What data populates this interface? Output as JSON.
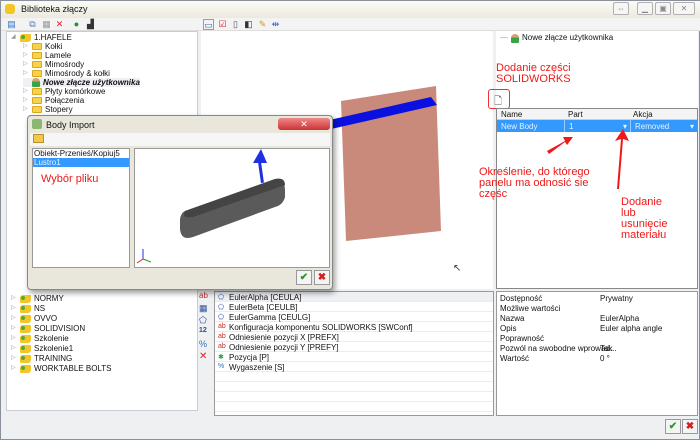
{
  "window": {
    "title": "Biblioteka złączy"
  },
  "tree": {
    "items": [
      {
        "label": "1.HAFELE",
        "type": "library",
        "level": 0,
        "expanded": true
      },
      {
        "label": "Kołki",
        "type": "folder",
        "level": 1
      },
      {
        "label": "Lamele",
        "type": "folder",
        "level": 1
      },
      {
        "label": "Mimośrody",
        "type": "folder",
        "level": 1
      },
      {
        "label": "Mimośrody & kołki",
        "type": "folder",
        "level": 1
      },
      {
        "label": "Nowe złącze użytkownika",
        "type": "user",
        "level": 1,
        "selected": true
      },
      {
        "label": "Płyty komórkowe",
        "type": "folder",
        "level": 1
      },
      {
        "label": "Połączenia",
        "type": "folder",
        "level": 1
      },
      {
        "label": "Stopery",
        "type": "folder",
        "level": 1
      }
    ],
    "items_lower": [
      "NORMY",
      "NS",
      "OVVO",
      "SOLIDVISION",
      "Szkolenie",
      "Szkolenie1",
      "TRAINING",
      "WORKTABLE BOLTS"
    ]
  },
  "right_tree": {
    "item": "Nowe złącze użytkownika"
  },
  "parts_table": {
    "headers": [
      "Name",
      "Part",
      "Akcja"
    ],
    "rows": [
      {
        "name": "New Body",
        "part": "1",
        "action": "Removed"
      }
    ]
  },
  "annotations": {
    "add_part": "Dodanie części SOLIDWORKS",
    "panel": "Określenie, do którego panelu ma odnosić sie częśc",
    "material": "Dodanie lub usunięcie materiału",
    "file": "Wybór pliku"
  },
  "dialog": {
    "title": "Body Import",
    "files": [
      "Obiekt-Przenieś/Kopiuj5",
      "Lustro1"
    ],
    "selected_index": 1
  },
  "properties": [
    {
      "icon": "angle",
      "label": "EulerAlpha [CEULA]"
    },
    {
      "icon": "angle",
      "label": "EulerBeta [CEULB]"
    },
    {
      "icon": "angle",
      "label": "EulerGamma [CEULG]"
    },
    {
      "icon": "text",
      "label": "Konfiguracja komponentu SOLIDWORKS [SWConf]"
    },
    {
      "icon": "text",
      "label": "Odniesienie pozycji X [PREFX]"
    },
    {
      "icon": "text",
      "label": "Odniesienie pozycji Y [PREFY]"
    },
    {
      "icon": "position",
      "label": "Pozycja [P]"
    },
    {
      "icon": "percent",
      "label": "Wygaszenie [S]"
    }
  ],
  "property_grid": [
    {
      "key": "Dostępność",
      "value": "Prywatny"
    },
    {
      "key": "Możliwe wartości",
      "value": ""
    },
    {
      "key": "Nazwa",
      "value": "EulerAlpha"
    },
    {
      "key": "Opis",
      "value": "Euler alpha angle"
    },
    {
      "key": "Poprawność",
      "value": ""
    },
    {
      "key": "Pozwól na swobodne wprowad...",
      "value": "Tak"
    },
    {
      "key": "Wartość",
      "value": "0 °"
    }
  ],
  "colors": {
    "selection": "#3399ff",
    "annotation": "#f01818",
    "blue_part": "#0a10e0",
    "pink_part": "#c98a7c"
  }
}
